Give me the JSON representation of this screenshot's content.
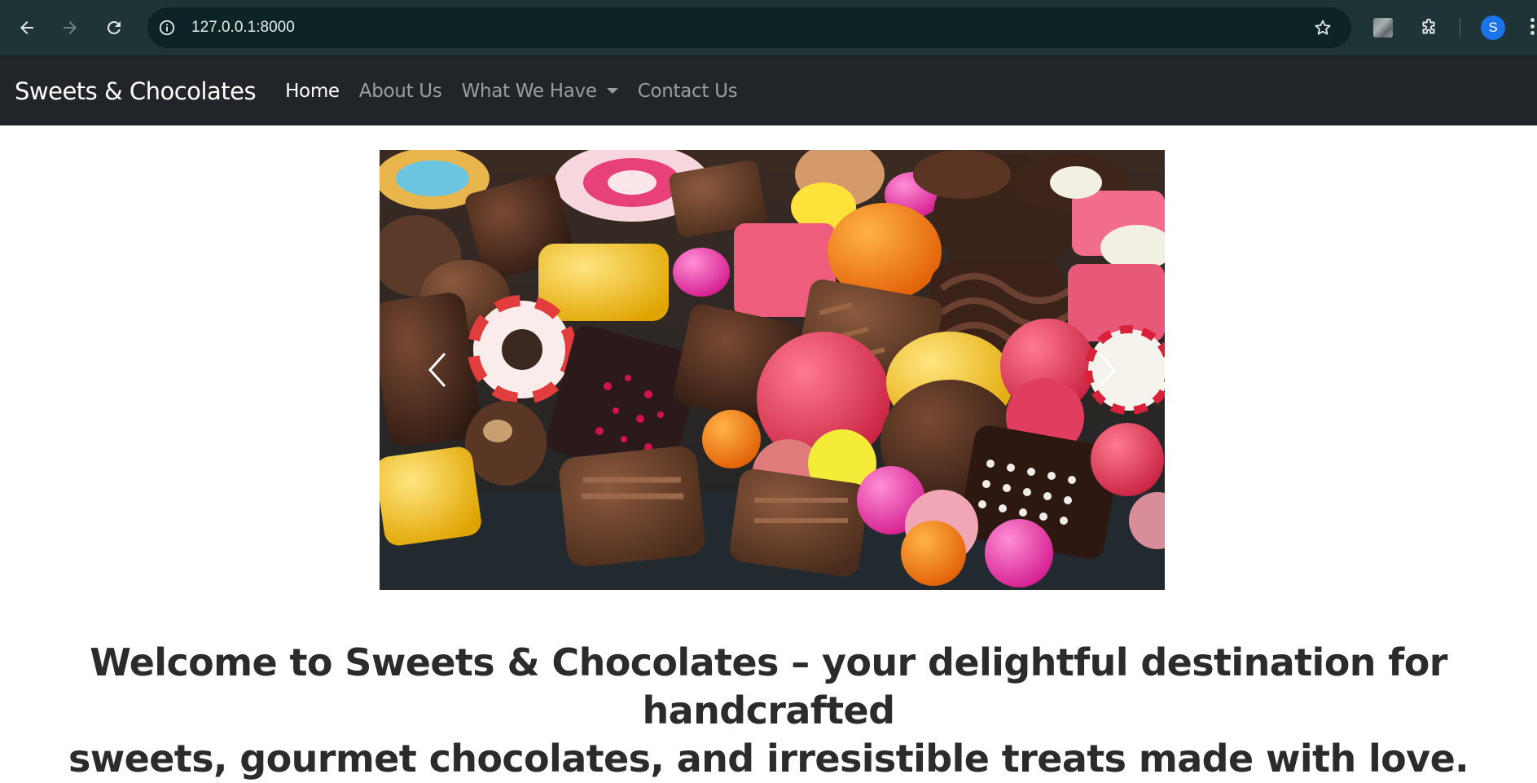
{
  "browser": {
    "url": "127.0.0.1:8000",
    "profile_initial": "S",
    "icons": [
      "back-arrow-icon",
      "forward-arrow-icon",
      "reload-icon",
      "site-info-icon",
      "bookmark-star-icon",
      "extension-thumbnail-icon",
      "extensions-puzzle-icon",
      "profile-avatar",
      "kebab-menu-icon"
    ]
  },
  "navbar": {
    "brand": "Sweets & Chocolates",
    "links": [
      {
        "label": "Home",
        "active": true
      },
      {
        "label": "About Us",
        "active": false
      },
      {
        "label": "What We Have",
        "dropdown": true
      },
      {
        "label": "Contact Us",
        "active": false
      }
    ]
  },
  "carousel": {
    "icons": [
      "carousel-prev-icon",
      "carousel-next-icon"
    ]
  },
  "welcome": {
    "line1": "Welcome to Sweets & Chocolates – your delightful destination for handcrafted",
    "line2": "sweets, gourmet chocolates, and irresistible treats made with love."
  },
  "colors": {
    "chrome_bg": "#1f3437",
    "omnibox_bg": "#0d2426",
    "navbar_bg": "#212529",
    "nav_active": "#ffffff",
    "nav_inactive": "#9a9d9f",
    "avatar_bg": "#1a73e8",
    "heading_text": "#2b2b2b"
  }
}
